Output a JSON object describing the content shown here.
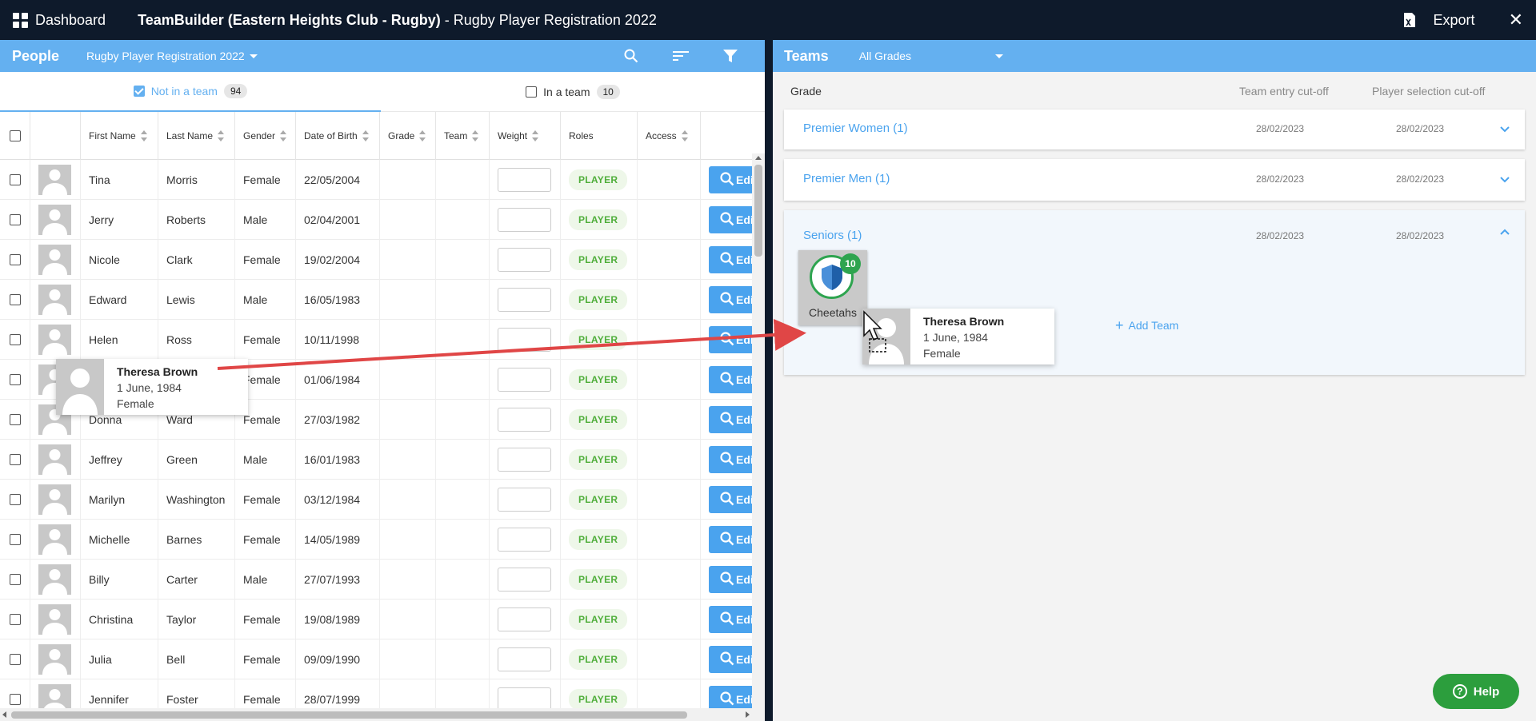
{
  "topbar": {
    "dashboard_label": "Dashboard",
    "title_bold": "TeamBuilder (Eastern Heights Club - Rugby)",
    "title_rest": " - Rugby Player Registration 2022",
    "export_label": "Export",
    "close_glyph": "✕"
  },
  "people": {
    "title": "People",
    "registration": "Rugby Player Registration 2022",
    "tabs": {
      "not_in_team": {
        "label": "Not in a team",
        "count": "94",
        "checked": true
      },
      "in_team": {
        "label": "In a team",
        "count": "10",
        "checked": false
      }
    },
    "columns": [
      "First Name",
      "Last Name",
      "Gender",
      "Date of Birth",
      "Grade",
      "Team",
      "Weight",
      "Roles",
      "Access"
    ],
    "role_label": "PLAYER",
    "edit_label": "Edit",
    "rows": [
      {
        "first": "Tina",
        "last": "Morris",
        "gender": "Female",
        "dob": "22/05/2004"
      },
      {
        "first": "Jerry",
        "last": "Roberts",
        "gender": "Male",
        "dob": "02/04/2001"
      },
      {
        "first": "Nicole",
        "last": "Clark",
        "gender": "Female",
        "dob": "19/02/2004"
      },
      {
        "first": "Edward",
        "last": "Lewis",
        "gender": "Male",
        "dob": "16/05/1983"
      },
      {
        "first": "Helen",
        "last": "Ross",
        "gender": "Female",
        "dob": "10/11/1998"
      },
      {
        "first": "",
        "last": "",
        "gender": "Female",
        "dob": "01/06/1984"
      },
      {
        "first": "Donna",
        "last": "Ward",
        "gender": "Female",
        "dob": "27/03/1982"
      },
      {
        "first": "Jeffrey",
        "last": "Green",
        "gender": "Male",
        "dob": "16/01/1983"
      },
      {
        "first": "Marilyn",
        "last": "Washington",
        "gender": "Female",
        "dob": "03/12/1984"
      },
      {
        "first": "Michelle",
        "last": "Barnes",
        "gender": "Female",
        "dob": "14/05/1989"
      },
      {
        "first": "Billy",
        "last": "Carter",
        "gender": "Male",
        "dob": "27/07/1993"
      },
      {
        "first": "Christina",
        "last": "Taylor",
        "gender": "Female",
        "dob": "19/08/1989"
      },
      {
        "first": "Julia",
        "last": "Bell",
        "gender": "Female",
        "dob": "09/09/1990"
      },
      {
        "first": "Jennifer",
        "last": "Foster",
        "gender": "Female",
        "dob": "28/07/1999"
      }
    ]
  },
  "teams": {
    "title": "Teams",
    "grade_filter": "All Grades",
    "headers": {
      "grade": "Grade",
      "team_entry": "Team entry cut-off",
      "player_selection": "Player selection cut-off"
    },
    "grades": [
      {
        "name": "Premier Women (1)",
        "entry": "28/02/2023",
        "selection": "28/02/2023",
        "expanded": false
      },
      {
        "name": "Premier Men (1)",
        "entry": "28/02/2023",
        "selection": "28/02/2023",
        "expanded": false
      },
      {
        "name": "Seniors (1)",
        "entry": "28/02/2023",
        "selection": "28/02/2023",
        "expanded": true
      }
    ],
    "team": {
      "name": "Cheetahs",
      "count": "10"
    },
    "add_team_label": "Add Team"
  },
  "drag_person": {
    "name": "Theresa Brown",
    "dob": "1 June, 1984",
    "gender": "Female"
  },
  "help_label": "Help",
  "colors": {
    "topbar": "#0e1a2b",
    "accent": "#64b0f0",
    "player_green": "#4fae3a",
    "team_green": "#2ea44f",
    "arrow": "#e04646"
  }
}
